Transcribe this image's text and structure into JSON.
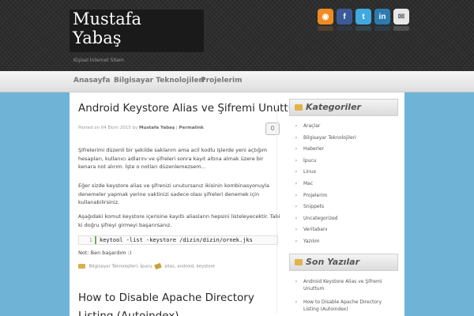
{
  "site": {
    "title": "Mustafa Yabaş",
    "tagline": "Kişisel İnternet Sitem"
  },
  "social": [
    {
      "name": "rss-icon",
      "glyph": "◉"
    },
    {
      "name": "facebook-icon",
      "glyph": "f"
    },
    {
      "name": "twitter-icon",
      "glyph": "t"
    },
    {
      "name": "linkedin-icon",
      "glyph": "in"
    },
    {
      "name": "mail-icon",
      "glyph": "✉"
    }
  ],
  "nav": [
    "Anasayfa",
    "Bilgisayar Teknolojileri",
    "Projelerim"
  ],
  "post": {
    "title": "Android Keystore Alias ve Şifremi Unuttum",
    "meta_prefix": "Posted on 04 Ekim 2015 by",
    "author": "Mustafa Yabaş",
    "permalink": "Permalink",
    "comments": "0",
    "p1": "Şifrelerimi düzenli bir şekilde saklarım ama acil kodlu işlerde yeni açtığım hesapları, kullanıcı adlarını ve şifreleri sonra kayıt altına almak üzere bir kenara not alırım. İşte o notları düzenlemezsem...",
    "p2": "Eğer sizde keystore alias ve şifrenizi unutursanız ikisinin kombinasyonuyla denemeler yapmak yerine vaktinizi sadece olası şifreleri denemek için kullanabilirsiniz.",
    "p3": "Aşağıdaki komut keystore içerisine kayıtlı aliasların hepsini listeleyecektir. Tabi ki doğru şifreyi girmeyi başarırsanız.",
    "code_line": "1",
    "code": "keytool -list -keystore /dizin/dizin/ornek.jks",
    "note": "Not: Ben başardım :)",
    "categories": "Bilgisayar Teknolojileri, İpucu",
    "tags": "alias, android, keystore"
  },
  "post2": {
    "title": "How to Disable Apache Directory Listing (Autoindex)"
  },
  "sidebar": {
    "categories_title": "Kategoriler",
    "categories": [
      "Araçlar",
      "Bilgisayar Teknolojileri",
      "Haberler",
      "İpucu",
      "Linux",
      "Mac",
      "Projelerim",
      "Snippets",
      "Uncategorized",
      "Veritabanı",
      "Yazılım"
    ],
    "recent_title": "Son Yazılar",
    "recent": [
      "Android Keystore Alias ve Şifremi Unuttum",
      "How to Disable Apache Directory Listing (Autoindex)"
    ]
  },
  "colors": {
    "header_bg": "#2b2b2b",
    "page_bg": "#6fb3d6",
    "code_accent": "#6ab04c"
  }
}
